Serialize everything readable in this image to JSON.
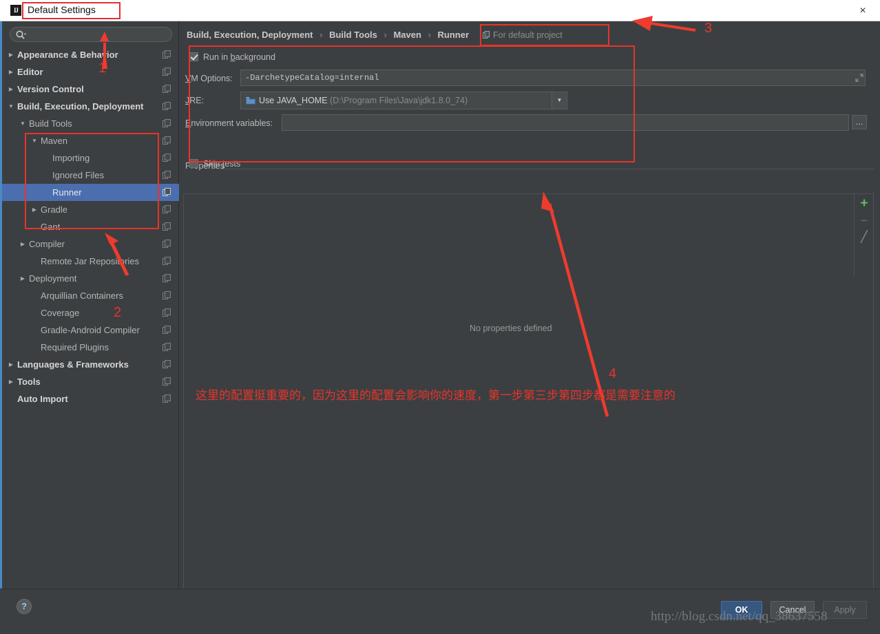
{
  "window": {
    "title": "Default Settings",
    "app_icon": "IJ",
    "close_label": "×"
  },
  "sidebar": {
    "search": {
      "placeholder": "",
      "value": "",
      "icon": "search-icon"
    },
    "items": [
      {
        "label": "Appearance & Behavior",
        "indent": 22,
        "arrow": "▶",
        "bold": true,
        "selected": false
      },
      {
        "label": "Editor",
        "indent": 22,
        "arrow": "▶",
        "bold": true,
        "selected": false
      },
      {
        "label": "Version Control",
        "indent": 22,
        "arrow": "▶",
        "bold": true,
        "selected": false
      },
      {
        "label": "Build, Execution, Deployment",
        "indent": 22,
        "arrow": "▼",
        "bold": true,
        "selected": false
      },
      {
        "label": "Build Tools",
        "indent": 39,
        "arrow": "▼",
        "bold": false,
        "selected": false
      },
      {
        "label": "Maven",
        "indent": 56,
        "arrow": "▼",
        "bold": false,
        "selected": false
      },
      {
        "label": "Importing",
        "indent": 73,
        "arrow": "",
        "bold": false,
        "selected": false
      },
      {
        "label": "Ignored Files",
        "indent": 73,
        "arrow": "",
        "bold": false,
        "selected": false
      },
      {
        "label": "Runner",
        "indent": 73,
        "arrow": "",
        "bold": false,
        "selected": true
      },
      {
        "label": "Gradle",
        "indent": 56,
        "arrow": "▶",
        "bold": false,
        "selected": false
      },
      {
        "label": "Gant",
        "indent": 56,
        "arrow": "",
        "bold": false,
        "selected": false
      },
      {
        "label": "Compiler",
        "indent": 39,
        "arrow": "▶",
        "bold": false,
        "selected": false
      },
      {
        "label": "Remote Jar Repositories",
        "indent": 56,
        "arrow": "",
        "bold": false,
        "selected": false
      },
      {
        "label": "Deployment",
        "indent": 39,
        "arrow": "▶",
        "bold": false,
        "selected": false
      },
      {
        "label": "Arquillian Containers",
        "indent": 56,
        "arrow": "",
        "bold": false,
        "selected": false
      },
      {
        "label": "Coverage",
        "indent": 56,
        "arrow": "",
        "bold": false,
        "selected": false
      },
      {
        "label": "Gradle-Android Compiler",
        "indent": 56,
        "arrow": "",
        "bold": false,
        "selected": false
      },
      {
        "label": "Required Plugins",
        "indent": 56,
        "arrow": "",
        "bold": false,
        "selected": false
      },
      {
        "label": "Languages & Frameworks",
        "indent": 22,
        "arrow": "▶",
        "bold": true,
        "selected": false
      },
      {
        "label": "Tools",
        "indent": 22,
        "arrow": "▶",
        "bold": true,
        "selected": false
      },
      {
        "label": "Auto Import",
        "indent": 22,
        "arrow": "",
        "bold": true,
        "selected": false
      }
    ]
  },
  "main": {
    "breadcrumb": {
      "parts": [
        "Build, Execution, Deployment",
        "Build Tools",
        "Maven",
        "Runner"
      ],
      "separator": "›"
    },
    "scope_badge": "For default project",
    "run_in_background": {
      "label": "Run in background",
      "checked": true
    },
    "vm_options": {
      "label": "VM Options:",
      "value": "-DarchetypeCatalog=internal"
    },
    "jre": {
      "label": "JRE:",
      "value": "Use JAVA_HOME",
      "path": "(D:\\Program Files\\Java\\jdk1.8.0_74)"
    },
    "environment_variables": {
      "label": "Environment variables:",
      "value": "",
      "browse": "..."
    },
    "properties_section": "Properties",
    "skip_tests": {
      "label": "Skip tests",
      "checked": false
    },
    "no_properties": "No properties defined",
    "toolbar": {
      "add": "+",
      "remove": "−",
      "edit": "╱"
    }
  },
  "footer": {
    "help": "?",
    "ok": "OK",
    "cancel": "Cancel",
    "apply": "Apply",
    "watermark": "http://blog.csdn.net/qq_38637558"
  },
  "annotations": {
    "numbers": [
      "1",
      "2",
      "3",
      "4"
    ],
    "note": "这里的配置挺重要的，因为这里的配置会影响你的速度，第一步第三步第四步都是需要注意的",
    "color": "#e8342a"
  }
}
